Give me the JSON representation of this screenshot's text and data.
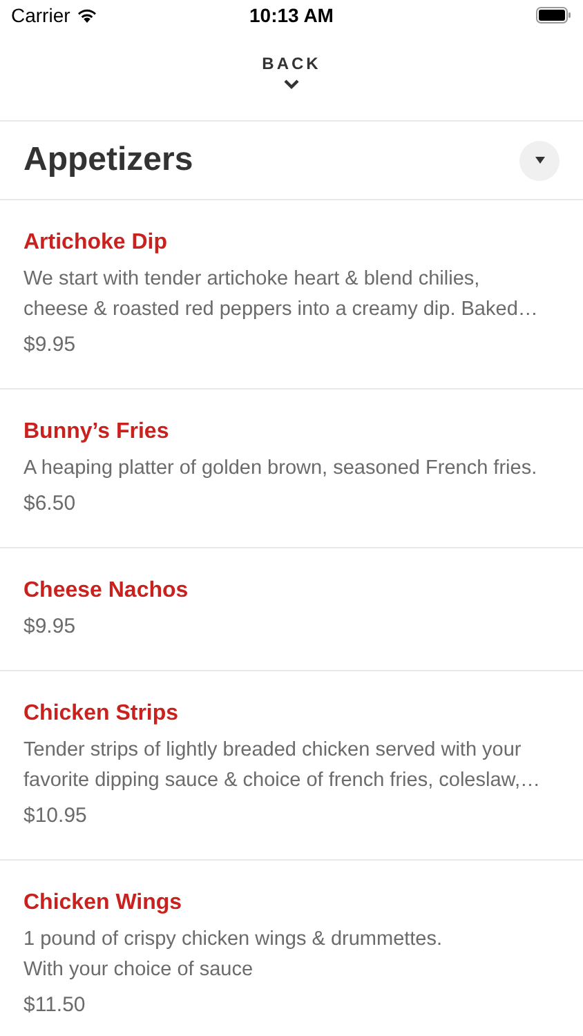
{
  "status_bar": {
    "carrier": "Carrier",
    "time": "10:13 AM"
  },
  "back": {
    "label": "BACK"
  },
  "section": {
    "title": "Appetizers"
  },
  "items": [
    {
      "name": "Artichoke Dip",
      "description": "We start with tender artichoke heart & blend chilies,\ncheese & roasted red peppers into a creamy dip. Baked…",
      "price": "$9.95"
    },
    {
      "name": "Bunny’s Fries",
      "description": "A heaping platter of golden brown, seasoned French fries.",
      "price": "$6.50"
    },
    {
      "name": "Cheese Nachos",
      "price": "$9.95"
    },
    {
      "name": "Chicken Strips",
      "description": "Tender strips of lightly breaded chicken served with your\nfavorite dipping sauce & choice of french fries, coleslaw,…",
      "price": "$10.95"
    },
    {
      "name": "Chicken Wings",
      "description": "1 pound of crispy chicken wings & drummettes.\nWith your choice of sauce",
      "price": "$11.50"
    }
  ]
}
